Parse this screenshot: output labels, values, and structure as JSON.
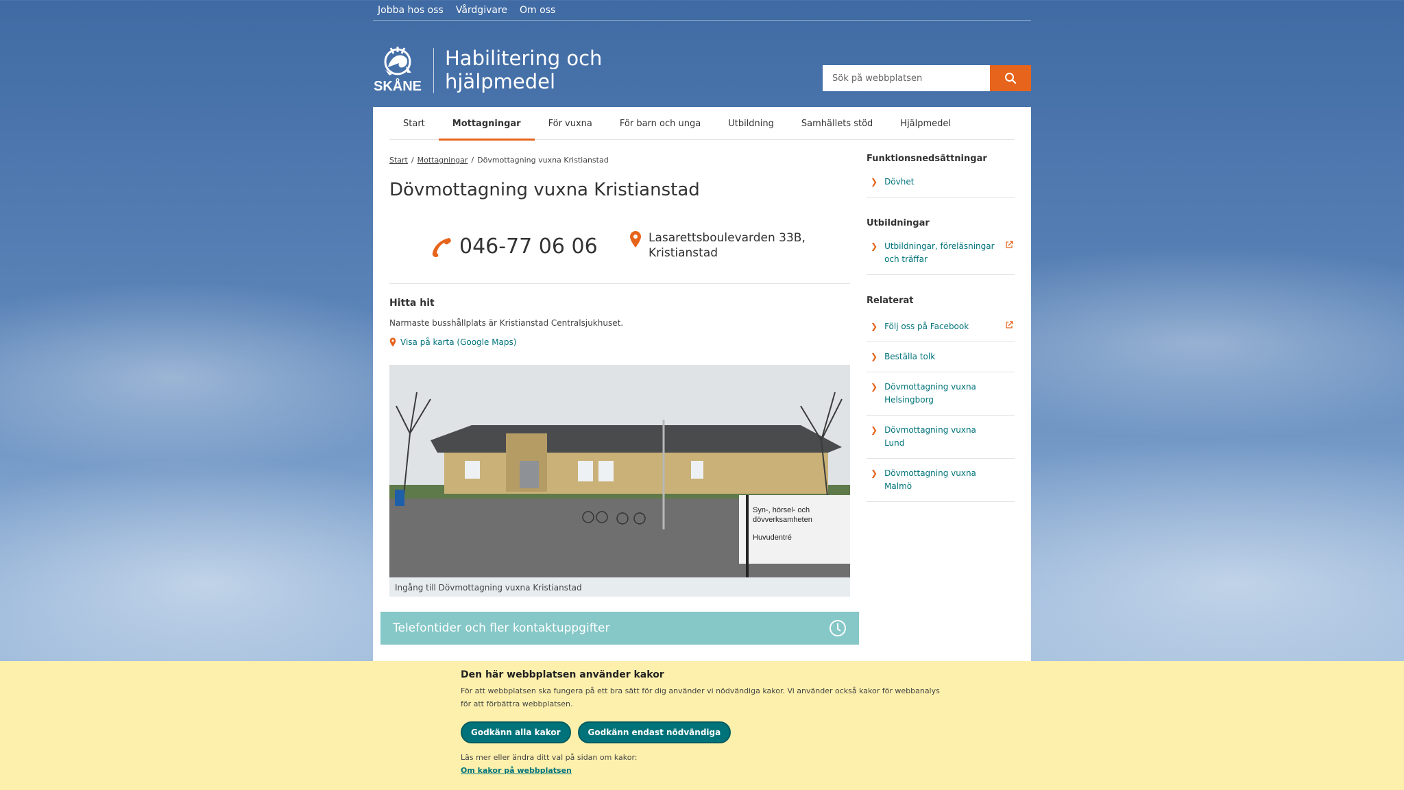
{
  "topnav": {
    "items": [
      "Jobba hos oss",
      "Vårdgivare",
      "Om oss"
    ]
  },
  "header": {
    "logo_text": "SKÅNE",
    "title_line1": "Habilitering och",
    "title_line2": "hjälpmedel",
    "search_placeholder": "Sök på webbplatsen"
  },
  "mainnav": {
    "tabs": [
      "Start",
      "Mottagningar",
      "För vuxna",
      "För barn och unga",
      "Utbildning",
      "Samhällets stöd",
      "Hjälpmedel"
    ],
    "active": "Mottagningar"
  },
  "breadcrumb": [
    "Start",
    "Mottagningar",
    "Dövmottagning vuxna Kristianstad"
  ],
  "page": {
    "title": "Dövmottagning vuxna Kristianstad",
    "phone": "046-77 06 06",
    "address_line1": "Lasarettsboulevarden 33B,",
    "address_line2": "Kristianstad",
    "find_heading": "Hitta hit",
    "find_text": "Narmaste busshållplats är Kristianstad Centralsjukhuset.",
    "map_link": "Visa på karta (Google Maps)",
    "photo_caption": "Ingång till Dövmottagning vuxna Kristianstad",
    "photo_sign_line1": "Syn-, hörsel- och",
    "photo_sign_line2": "dövverksamheten",
    "photo_sign_line3": "Huvudentré",
    "accordion_label": "Telefontider och fler kontaktuppgifter"
  },
  "sidebar": {
    "groups": [
      {
        "heading": "Funktionsnedsättningar",
        "items": [
          "Dövhet"
        ]
      },
      {
        "heading": "Utbildningar",
        "items": [
          "Utbildningar, föreläsningar och träffar"
        ]
      },
      {
        "heading": "Relaterat",
        "items": [
          "Följ oss på Facebook",
          "Beställa tolk",
          "Dövmottagning vuxna Helsingborg",
          "Dövmottagning vuxna Lund",
          "Dövmottagning vuxna Malmö"
        ]
      }
    ]
  },
  "cookie": {
    "title": "Den här webbplatsen använder kakor",
    "text": "För att webbplatsen ska fungera på ett bra sätt för dig använder vi nödvändiga kakor. Vi använder också kakor för webbanalys för att förbättra webbplatsen.",
    "accept_all": "Godkänn alla kakor",
    "accept_necessary": "Godkänn endast nödvändiga",
    "more_text": "Läs mer eller ändra ditt val på sidan om kakor:",
    "more_link": "Om kakor på webbplatsen"
  },
  "colors": {
    "accent": "#e6641c",
    "link": "#00737a",
    "cookie_bg": "#fdf0ac",
    "accordion": "#86c7c7"
  }
}
